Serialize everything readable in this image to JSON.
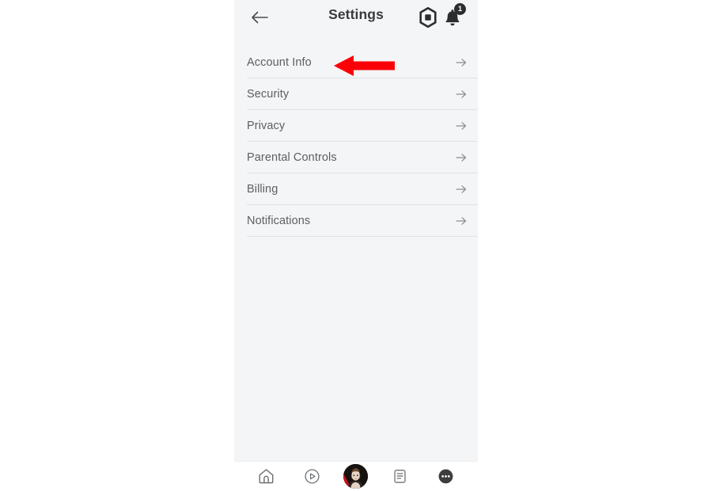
{
  "screen": {
    "background_color": "#ffffff",
    "panel_color": "#f4f5f6",
    "accent_color": "#ff0000",
    "text_color": "#5c5f61"
  },
  "header": {
    "title": "Settings",
    "back_icon": "back-arrow-icon",
    "robux_icon": "robux-hexagon-icon",
    "bell_icon": "bell-icon",
    "notification_count": "1"
  },
  "settings": {
    "items": [
      {
        "label": "Account Info",
        "chevron": "chevron-right-icon"
      },
      {
        "label": "Security",
        "chevron": "chevron-right-icon"
      },
      {
        "label": "Privacy",
        "chevron": "chevron-right-icon"
      },
      {
        "label": "Parental Controls",
        "chevron": "chevron-right-icon"
      },
      {
        "label": "Billing",
        "chevron": "chevron-right-icon"
      },
      {
        "label": "Notifications",
        "chevron": "chevron-right-icon"
      }
    ]
  },
  "annotation": {
    "type": "arrow",
    "direction": "left",
    "color": "#ff0000",
    "points_at": "Account Info"
  },
  "bottom_nav": {
    "items": [
      {
        "icon": "home-icon"
      },
      {
        "icon": "play-circle-icon"
      },
      {
        "icon": "avatar-icon"
      },
      {
        "icon": "chat-document-icon"
      },
      {
        "icon": "more-ellipsis-icon"
      }
    ]
  }
}
